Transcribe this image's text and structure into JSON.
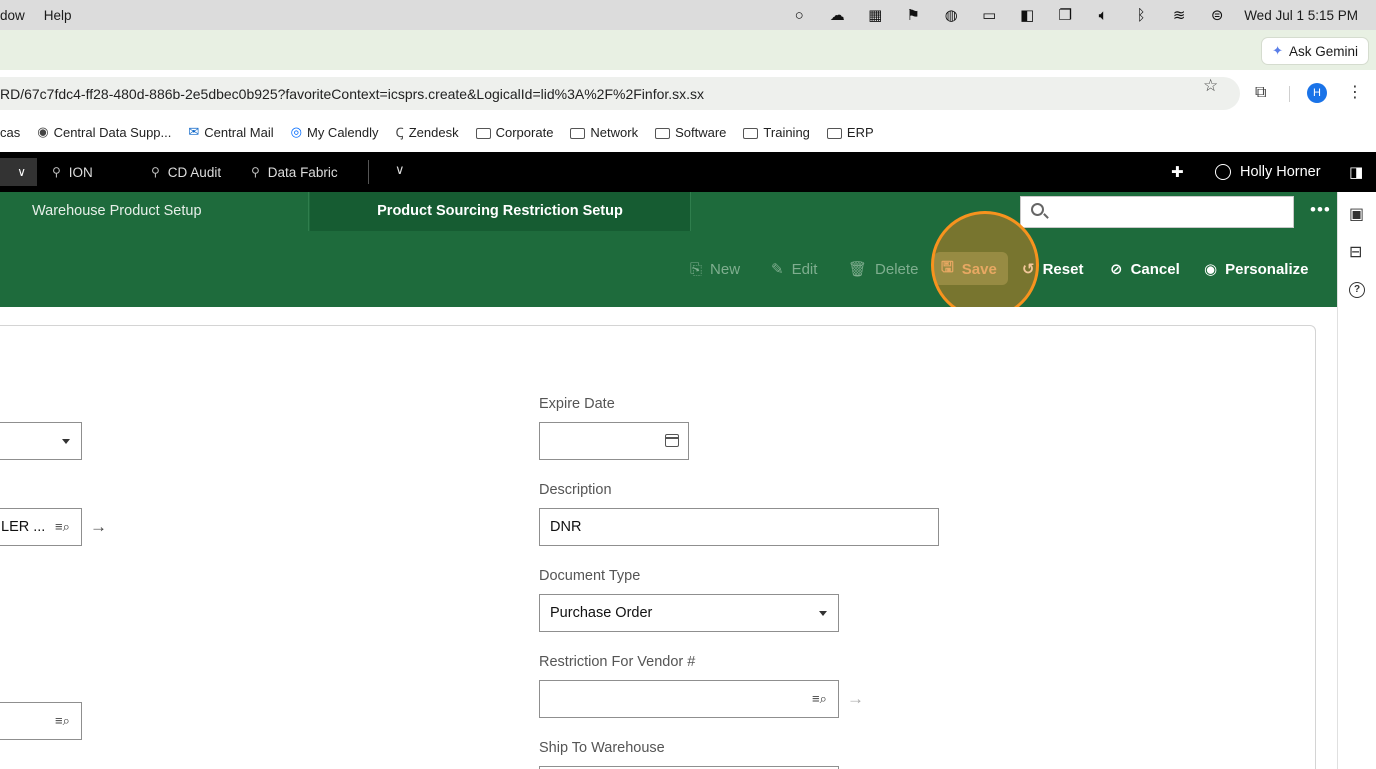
{
  "mac_menu": {
    "items": [
      "dow",
      "Help"
    ],
    "clock": "Wed Jul 1  5:15 PM"
  },
  "gemini": {
    "label": "Ask Gemini"
  },
  "browser": {
    "url": "RD/67c7fdc4-ff28-480d-886b-2e5dbec0b925?favoriteContext=icsprs.create&LogicalId=lid%3A%2F%2Finfor.sx.sx",
    "avatar_initial": "H"
  },
  "bookmarks": [
    {
      "label": "cas",
      "icon": "none"
    },
    {
      "label": "Central Data Supp...",
      "icon": "globe-icon"
    },
    {
      "label": "Central Mail",
      "icon": "outlook-icon"
    },
    {
      "label": "My Calendly",
      "icon": "calendly-icon"
    },
    {
      "label": "Zendesk",
      "icon": "zendesk-icon"
    },
    {
      "label": "Corporate",
      "icon": "folder-icon"
    },
    {
      "label": "Network",
      "icon": "folder-icon"
    },
    {
      "label": "Software",
      "icon": "folder-icon"
    },
    {
      "label": "Training",
      "icon": "folder-icon"
    },
    {
      "label": "ERP",
      "icon": "folder-icon"
    }
  ],
  "app_header": {
    "tabs": [
      "ION",
      "CD Audit",
      "Data Fabric"
    ],
    "user": "Holly Horner"
  },
  "module_tabs": {
    "inactive": "Warehouse Product Setup",
    "active": "Product Sourcing Restriction Setup"
  },
  "toolbar": {
    "new": "New",
    "edit": "Edit",
    "delete": "Delete",
    "save": "Save",
    "reset": "Reset",
    "cancel": "Cancel",
    "personalize": "Personalize"
  },
  "form": {
    "left_vendor_value": "LER ...",
    "expire_date": {
      "label": "Expire Date",
      "value": ""
    },
    "description": {
      "label": "Description",
      "value": "DNR"
    },
    "document_type": {
      "label": "Document Type",
      "value": "Purchase Order"
    },
    "restriction_vendor": {
      "label": "Restriction For Vendor #",
      "value": ""
    },
    "ship_to_warehouse": {
      "label": "Ship To Warehouse"
    }
  },
  "colors": {
    "green_primary": "#1e6b3c",
    "green_dark": "#165c32",
    "highlight_orange": "#f7931e"
  }
}
